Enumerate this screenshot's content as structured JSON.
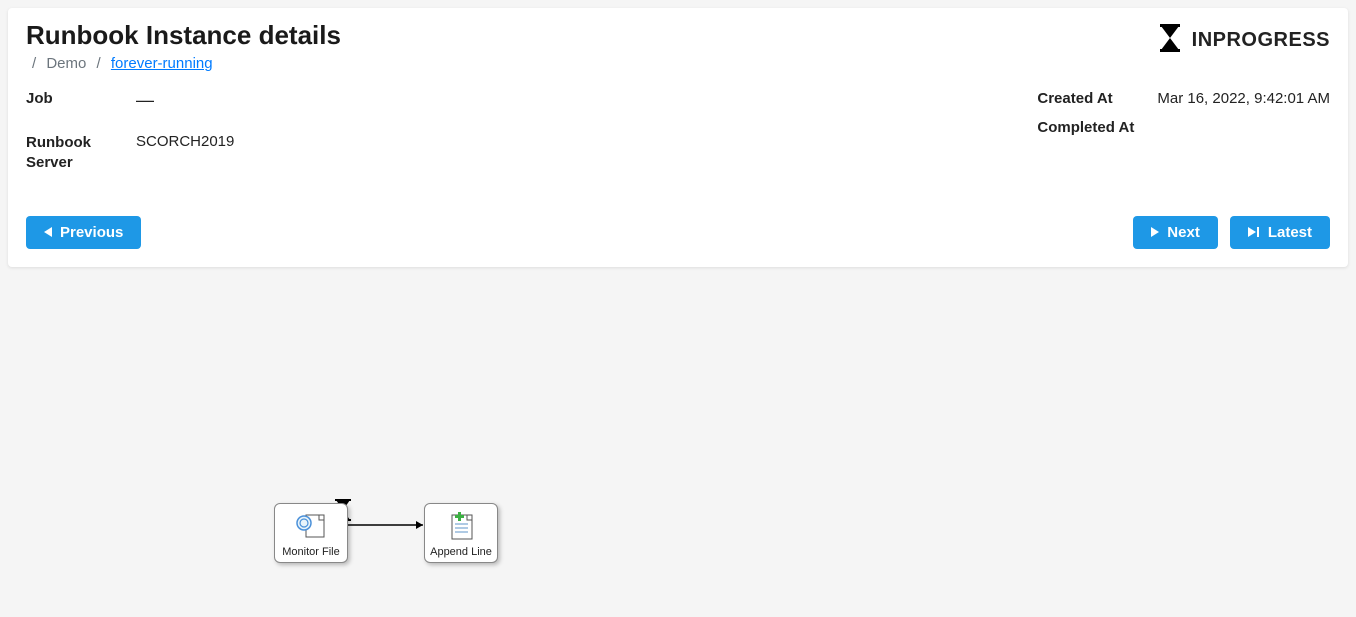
{
  "header": {
    "title": "Runbook Instance details",
    "breadcrumb": {
      "crumb1": "Demo",
      "crumb2": "forever-running"
    },
    "status": "INPROGRESS"
  },
  "details": {
    "job_label": "Job",
    "job_value": "—",
    "runbook_server_label": "Runbook Server",
    "runbook_server_value": "SCORCH2019",
    "created_at_label": "Created At",
    "created_at_value": "Mar 16, 2022, 9:42:01 AM",
    "completed_at_label": "Completed At",
    "completed_at_value": ""
  },
  "nav": {
    "previous": "Previous",
    "next": "Next",
    "latest": "Latest"
  },
  "diagram": {
    "node1": "Monitor File",
    "node2": "Append Line"
  }
}
